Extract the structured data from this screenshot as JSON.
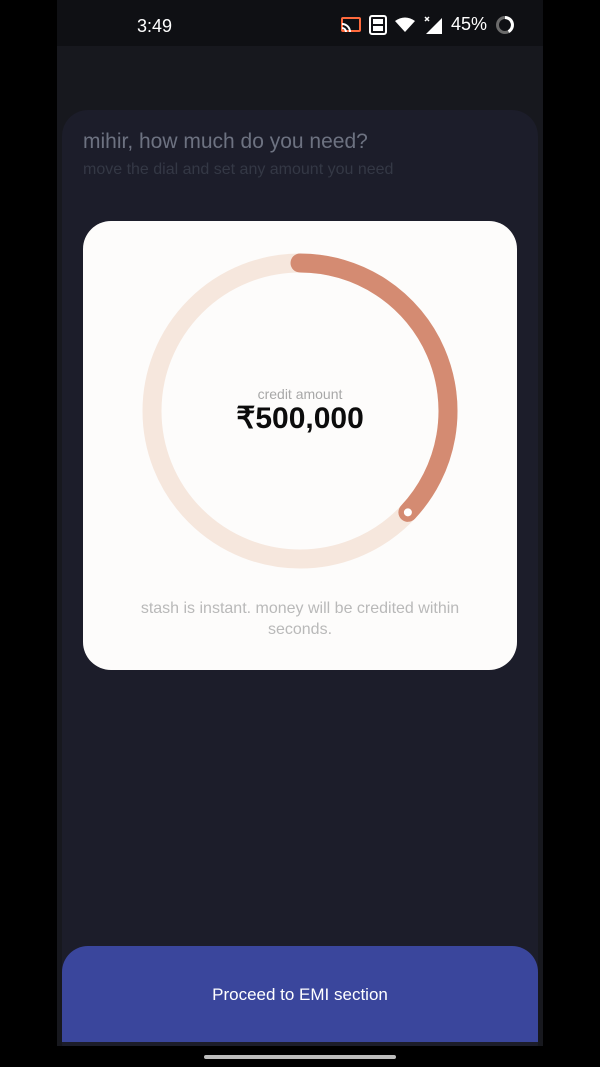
{
  "status_bar": {
    "time": "3:49",
    "battery": "45%",
    "icons": [
      "cast-icon",
      "volte-icon",
      "wifi-icon",
      "signal-icon",
      "battery-icon"
    ]
  },
  "header": {
    "title": "mihir, how much do you need?",
    "subtitle": "move the dial and set any amount you need"
  },
  "dial": {
    "label": "credit amount",
    "amount": "₹500,000",
    "fill_fraction": 0.37,
    "colors": {
      "track": "#f6e7dd",
      "progress": "#d48b72",
      "knob": "#ffffff"
    }
  },
  "card": {
    "note": "stash is instant. money will be credited within seconds."
  },
  "footer": {
    "proceed_label": "Proceed to EMI section",
    "button_color": "#3a469c"
  }
}
